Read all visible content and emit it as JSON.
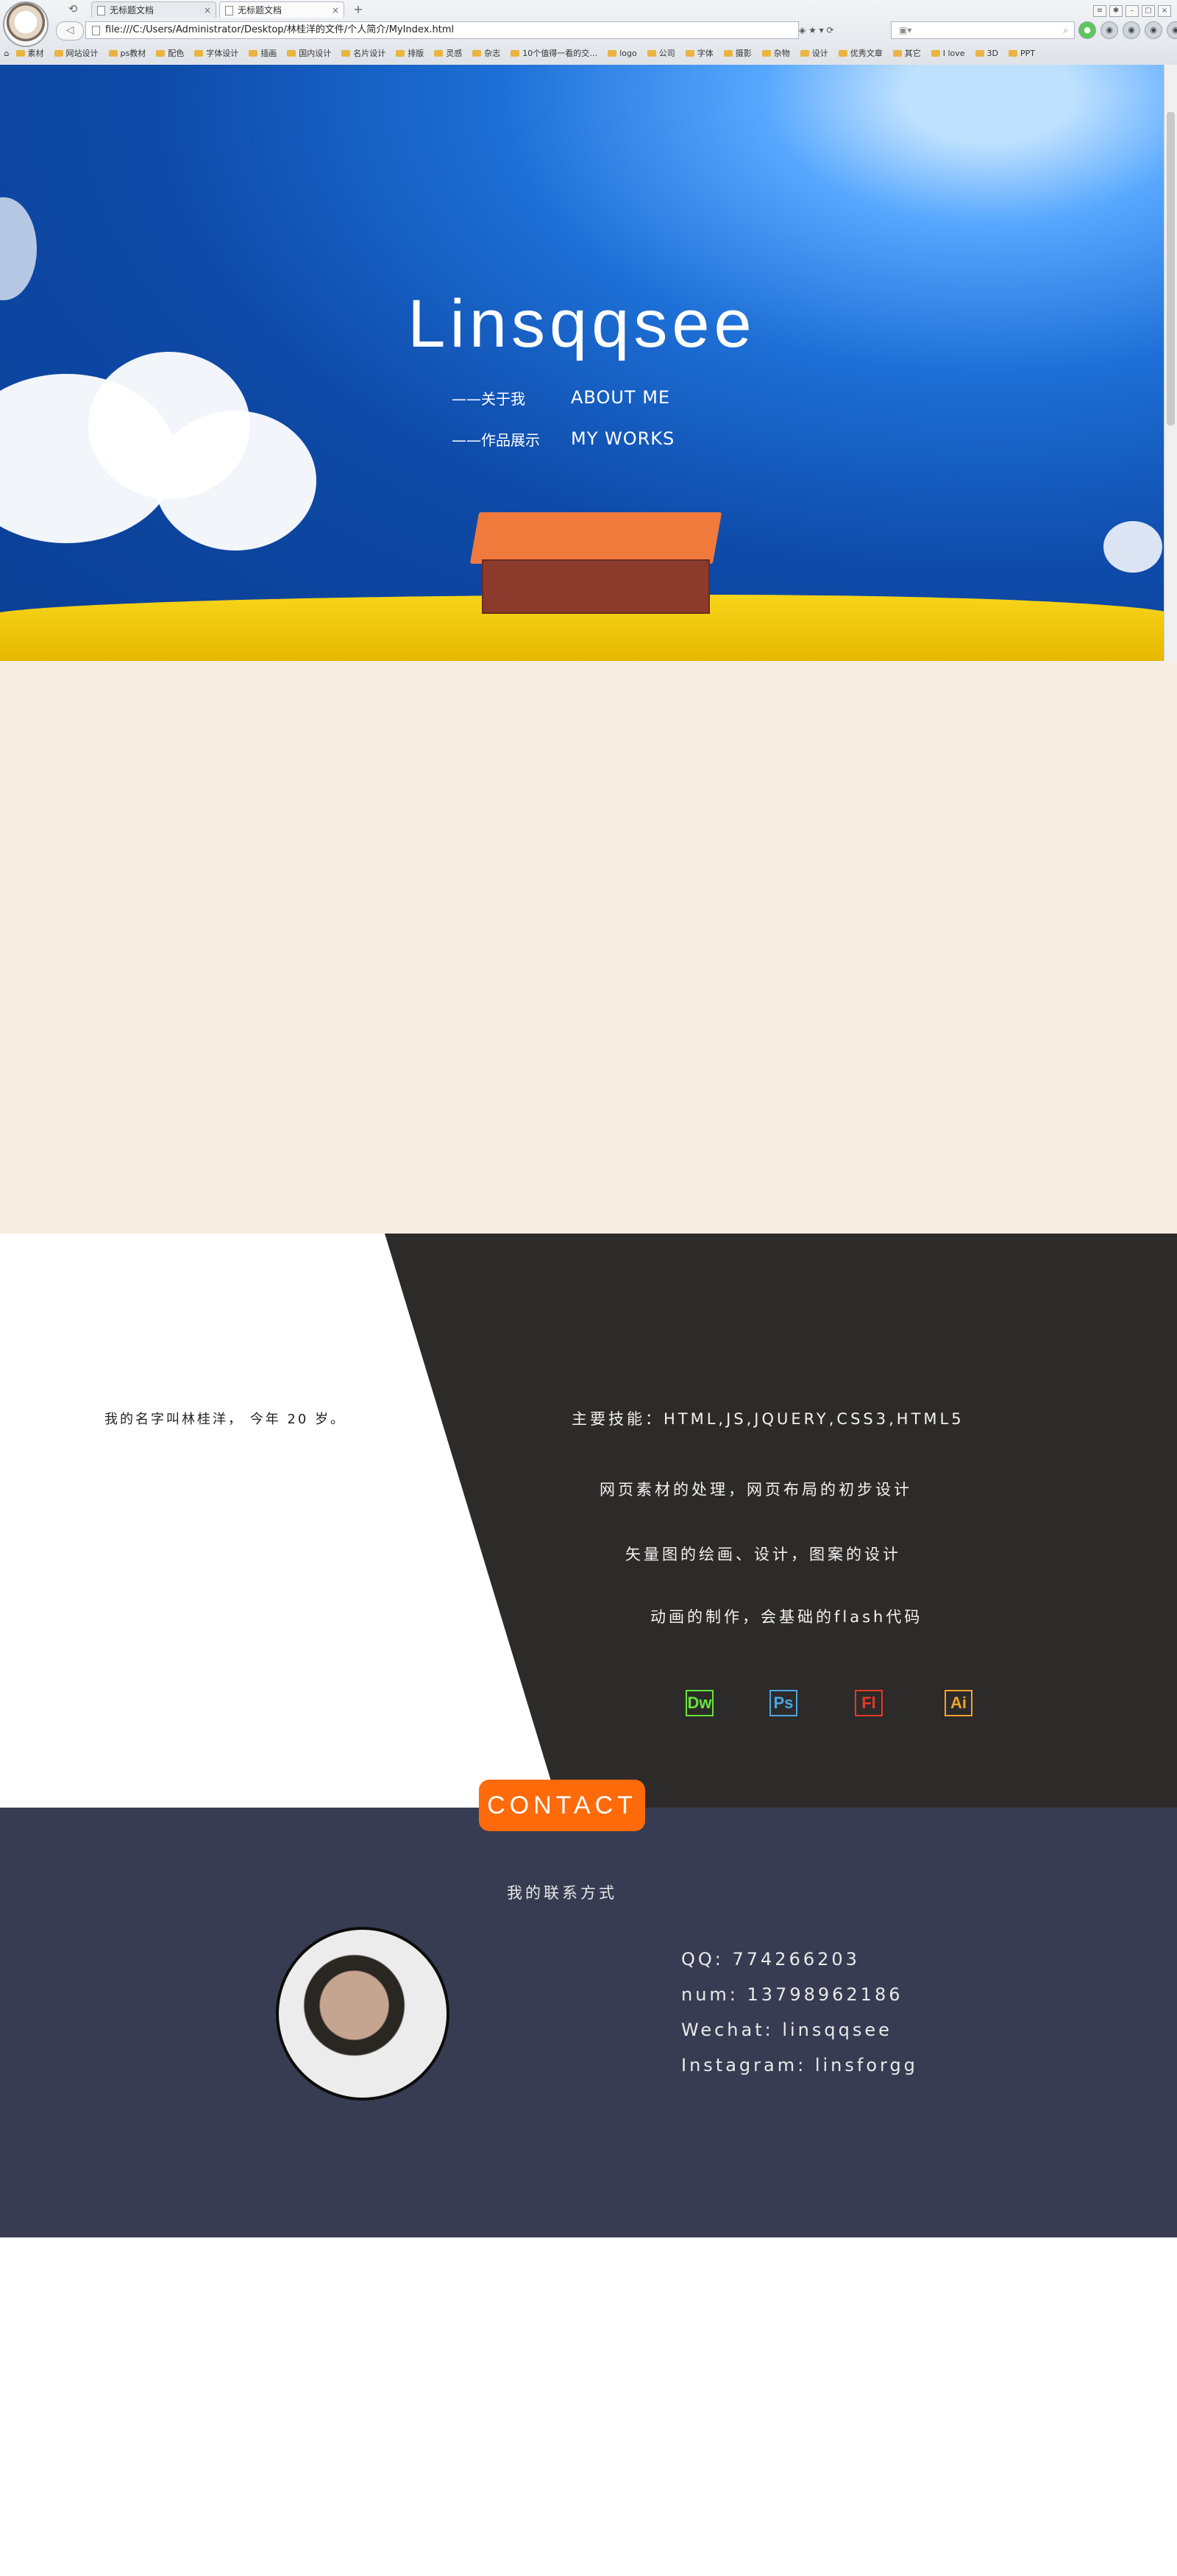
{
  "browser": {
    "tabs": [
      "无标题文档",
      "无标题文档"
    ],
    "url": "file:///C:/Users/Administrator/Desktop/林桂洋的文件/个人简介/MyIndex.html",
    "bookmarks": [
      "素材",
      "网站设计",
      "ps教材",
      "配色",
      "字体设计",
      "插画",
      "国内设计",
      "名片设计",
      "排版",
      "灵感",
      "杂志",
      "10个值得一看的交…",
      "logo",
      "公司",
      "字体",
      "摄影",
      "杂物",
      "设计",
      "优秀文章",
      "其它",
      "I love",
      "3D",
      "PPT"
    ]
  },
  "hero": {
    "title": "Linsqqsee",
    "menu": [
      {
        "cn": "——关于我",
        "en": "ABOUT ME"
      },
      {
        "cn": "——作品展示",
        "en": "MY WORKS"
      }
    ]
  },
  "about": {
    "intro": "我的名字叫林桂洋， 今年 20 岁。",
    "skills": [
      "主要技能：HTML,JS,JQUERY,CSS3,HTML5",
      "网页素材的处理，网页布局的初步设计",
      "矢量图的绘画、设计，图案的设计",
      "动画的制作，会基础的flash代码"
    ],
    "software": [
      {
        "label": "Dw",
        "color": "#66e43a"
      },
      {
        "label": "Ps",
        "color": "#4aa8df"
      },
      {
        "label": "Fl",
        "color": "#e5392b"
      },
      {
        "label": "Ai",
        "color": "#f3a32b"
      }
    ]
  },
  "contact": {
    "badge": "CONTACT",
    "subtitle": "我的联系方式",
    "lines": [
      "QQ: 774266203",
      "num: 13798962186",
      "Wechat: linsqqsee",
      "Instagram: linsforgg"
    ]
  },
  "colors": {
    "beige": "#f7ede3",
    "dark": "#2d2a2a",
    "contact_bg": "#373c52",
    "accent": "#ff6a0a"
  }
}
